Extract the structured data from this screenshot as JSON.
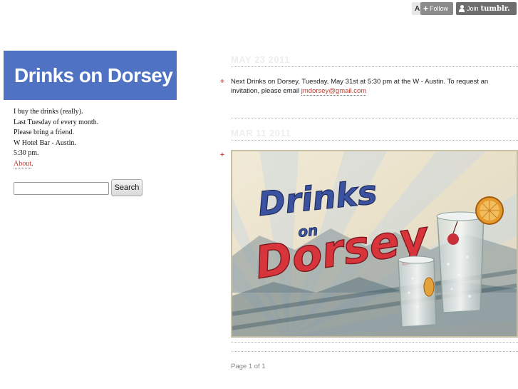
{
  "tumblr_bar": {
    "ghost_label": "Ar",
    "follow_label": "Follow",
    "join_label": "Join",
    "brand": "tumblr."
  },
  "blog": {
    "title": "Drinks on Dorsey",
    "description": [
      "I buy the drinks (really).",
      "Last Tuesday of every month.",
      "Please bring a friend.",
      "W Hotel Bar - Austin.",
      "5:30 pm."
    ],
    "about_link": "About",
    "about_suffix": "."
  },
  "search": {
    "button_label": "Search",
    "value": ""
  },
  "posts": [
    {
      "date": "MAY 23 2011",
      "text": "Next Drinks on Dorsey, Tuesday, May 31st at 5:30 pm at the W - Austin.  To request an invitation, please email ",
      "email": "jmdorsey@gmail.com"
    },
    {
      "date": "MAR 11 2011",
      "image_alt": "Drinks on Dorsey poster with cocktail glasses",
      "image_text": {
        "line1": "Drinks",
        "line2": "on",
        "line3": "Dorsey"
      }
    }
  ],
  "pagination": {
    "label": "Page 1 of 1"
  },
  "colors": {
    "accent": "#4f72c3",
    "link": "#c0392b",
    "poster_red": "#d8343c",
    "poster_blue": "#3a52a0"
  }
}
